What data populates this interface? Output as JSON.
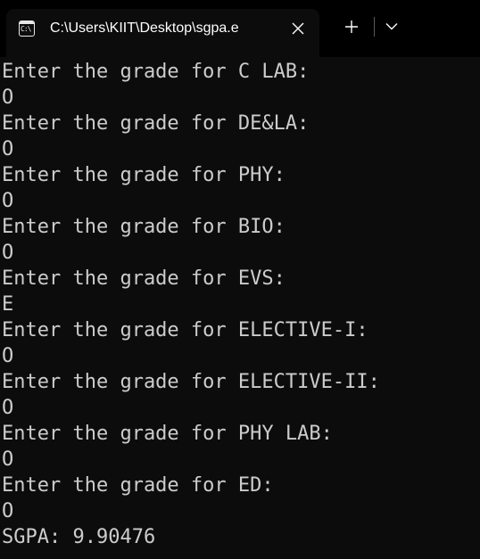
{
  "titlebar": {
    "tab_icon_glyph": "C:\\",
    "tab_title": "C:\\Users\\KIIT\\Desktop\\sgpa.e",
    "close_icon": "close-icon",
    "new_tab_icon": "plus-icon",
    "dropdown_icon": "chevron-down-icon"
  },
  "colors": {
    "titlebar_bg": "#000000",
    "terminal_bg": "#0c0c0c",
    "terminal_text": "#cccccc",
    "tab_text": "#ffffff"
  },
  "terminal": {
    "lines": [
      "Enter the grade for C LAB:",
      "O",
      "Enter the grade for DE&LA:",
      "O",
      "Enter the grade for PHY:",
      "O",
      "Enter the grade for BIO:",
      "O",
      "Enter the grade for EVS:",
      "E",
      "Enter the grade for ELECTIVE-I:",
      "O",
      "Enter the grade for ELECTIVE-II:",
      "O",
      "Enter the grade for PHY LAB:",
      "O",
      "Enter the grade for ED:",
      "O",
      "SGPA: 9.90476"
    ]
  }
}
